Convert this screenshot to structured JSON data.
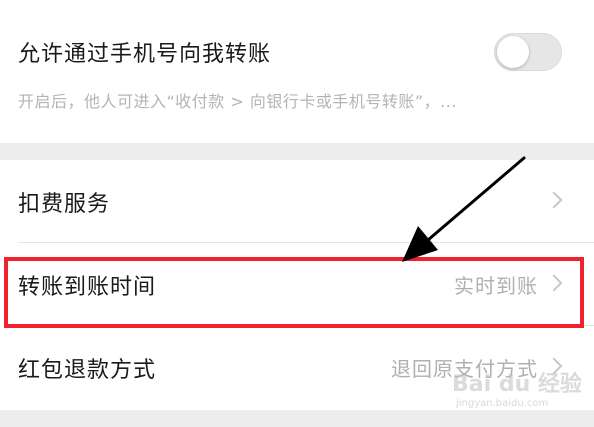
{
  "phone_transfer": {
    "title": "允许通过手机号向我转账",
    "description": "开启后，他人可进入“收付款 > 向银行卡或手机号转账”，...",
    "enabled": false
  },
  "list": [
    {
      "label": "扣费服务",
      "value": ""
    },
    {
      "label": "转账到账时间",
      "value": "实时到账"
    },
    {
      "label": "红包退款方式",
      "value": "退回原支付方式"
    }
  ],
  "annotation": {
    "highlight_color": "#f0232d",
    "arrow_color": "#000000"
  },
  "watermark": {
    "text": "Bai du 经验",
    "sub": "jingyan.baidu.com"
  }
}
